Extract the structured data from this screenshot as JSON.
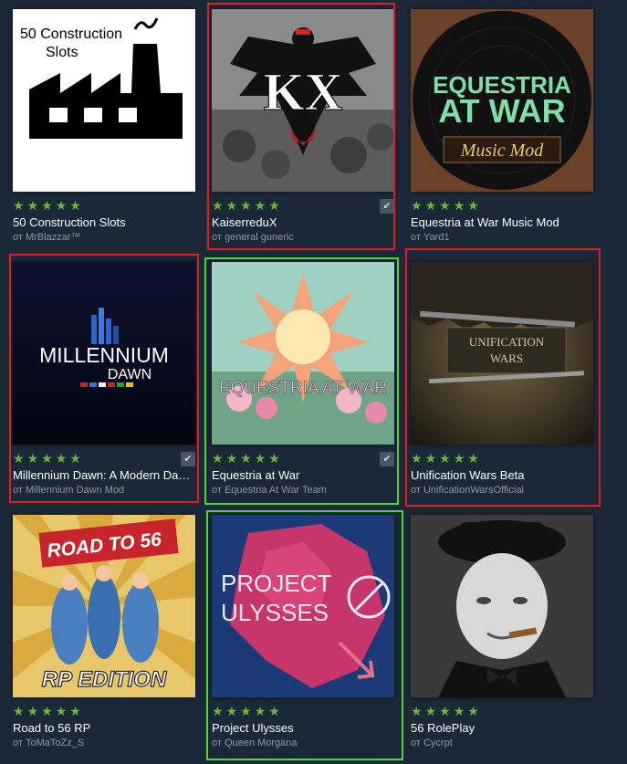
{
  "items": [
    {
      "title": "50 Construction Slots",
      "author": "от MrBlazzar™",
      "thumb_text": "50 Construction\nSlots",
      "subscribed": false
    },
    {
      "title": "KaiserreduX",
      "author": "от general guneric",
      "thumb_text": "KX",
      "subscribed": true
    },
    {
      "title": "Equestria at War Music Mod",
      "author": "от Yard1",
      "thumb_text": [
        "EQUESTRIA",
        "AT WAR",
        "Music Mod"
      ],
      "subscribed": false
    },
    {
      "title": "Millennium Dawn: A Modern Day Mod",
      "author": "от Millennium Dawn Mod",
      "thumb_text": [
        "MILLENNIUM",
        "DAWN"
      ],
      "subscribed": true
    },
    {
      "title": "Equestria at War",
      "author": "от Equestria At War Team",
      "thumb_text": "EQUESTRIA AT WAR",
      "subscribed": true
    },
    {
      "title": "Unification Wars Beta",
      "author": "от UnificationWarsOfficial",
      "thumb_text": [
        "UNIFICATION",
        "WARS"
      ],
      "subscribed": false
    },
    {
      "title": "Road to 56 RP",
      "author": "от ToMaToZz_S",
      "thumb_text": [
        "ROAD TO 56",
        "RP EDITION"
      ],
      "subscribed": false
    },
    {
      "title": "Project Ulysses",
      "author": "от Queen Morgana",
      "thumb_text": [
        "PROJECT",
        "ULYSSES"
      ],
      "subscribed": false
    },
    {
      "title": "56 RolePlay",
      "author": "от Cycrpt",
      "thumb_text": "",
      "subscribed": false
    }
  ],
  "rating_stars": 5,
  "checkmark_glyph": "✔",
  "colors": {
    "background": "#1b2838",
    "star": "#6cb33f",
    "highlight_red": "#e01c1c",
    "highlight_green": "#52d62f"
  }
}
